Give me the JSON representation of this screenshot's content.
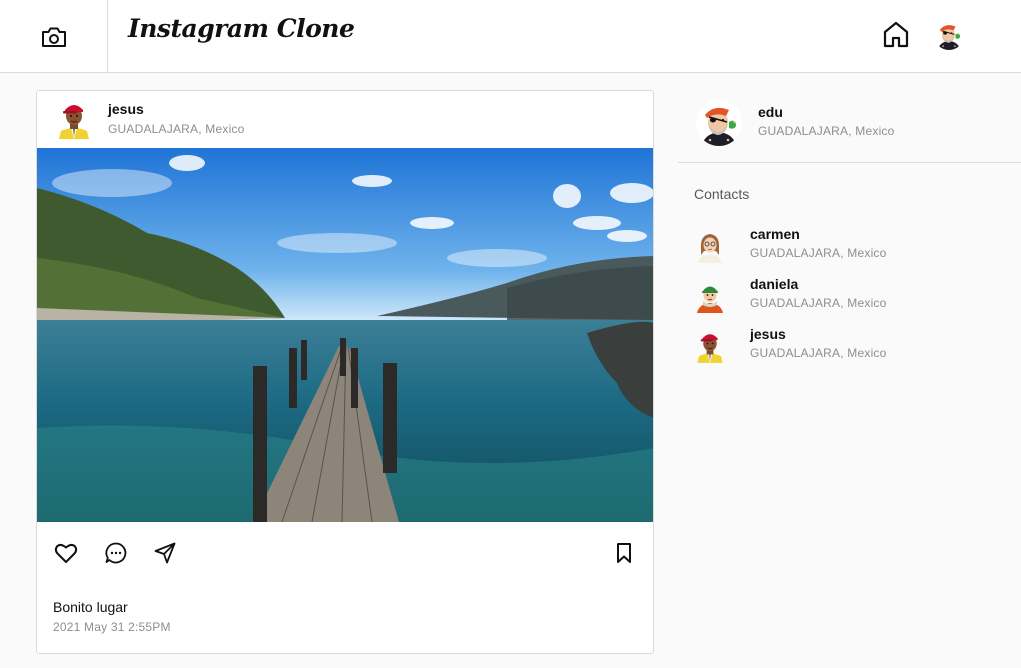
{
  "header": {
    "brand": "Instagram Clone",
    "camera_icon": "camera-icon",
    "home_icon": "home-icon",
    "avatar_icon": "pirate-avatar"
  },
  "post": {
    "username": "jesus",
    "location": "GUADALAJARA, Mexico",
    "avatar_icon": "man-red-cap-avatar",
    "image_icon": "lake-pier-photo",
    "actions": [
      "heart-icon",
      "comment-icon",
      "send-icon",
      "bookmark-icon"
    ],
    "caption": "Bonito lugar",
    "timestamp": "2021 May 31 2:55PM"
  },
  "sidebar": {
    "me": {
      "username": "edu",
      "location": "GUADALAJARA, Mexico",
      "avatar_icon": "pirate-avatar"
    },
    "contacts_title": "Contacts",
    "contacts": [
      {
        "username": "carmen",
        "location": "GUADALAJARA, Mexico",
        "avatar_icon": "woman-glasses-avatar"
      },
      {
        "username": "daniela",
        "location": "GUADALAJARA, Mexico",
        "avatar_icon": "woman-green-hat-avatar"
      },
      {
        "username": "jesus",
        "location": "GUADALAJARA, Mexico",
        "avatar_icon": "man-red-cap-avatar"
      }
    ]
  },
  "colors": {
    "border": "#dbdbdb",
    "background": "#fafafa",
    "muted_text": "#8e8e8e",
    "sky": "#3a8fd9",
    "water": "#1f6a86"
  }
}
